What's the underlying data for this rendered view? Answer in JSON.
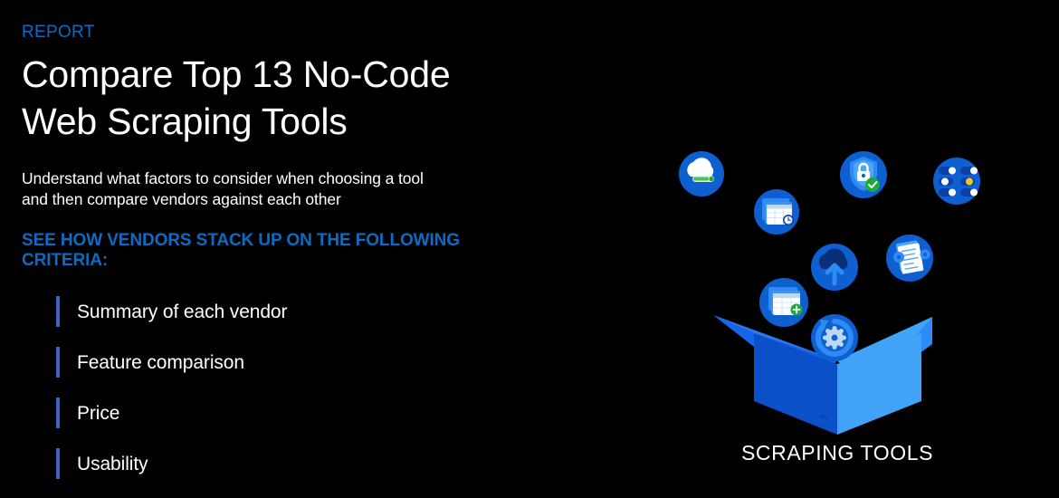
{
  "theme": {
    "background": "#000000",
    "accent_blue": "#0C6BC4",
    "bullet_bar": "#3F63C8",
    "text_white": "#FFFFFF",
    "box_left_face": "#0B50C8",
    "box_right_face": "#41A3F5",
    "box_left_flap": "#1565E8",
    "box_right_flap": "#2E8BF5",
    "icon_circle": "#0E5FD0",
    "icon_circle_dark": "#0B3FA8",
    "icon_light_blue": "#3A95F0",
    "badge_green": "#1FA938",
    "accent_yellow": "#F5C518"
  },
  "eyebrow": "REPORT",
  "headline": {
    "line1": "Compare Top 13 No-Code",
    "line2": "Web Scraping Tools"
  },
  "subcopy": {
    "line1": "Understand what factors to consider when choosing a tool",
    "line2": "and then compare vendors against each other"
  },
  "criteria_heading": {
    "line1": "SEE HOW VENDORS STACK UP ON THE FOLLOWING",
    "line2": "CRITERIA:"
  },
  "criteria": [
    {
      "label": "Summary of each vendor"
    },
    {
      "label": "Feature comparison"
    },
    {
      "label": "Price"
    },
    {
      "label": "Usability"
    }
  ],
  "illustration": {
    "box_label": "SCRAPING TOOLS",
    "icons": [
      {
        "name": "cloud-sync-icon",
        "alt": "cloud with green progress bar"
      },
      {
        "name": "spreadsheet-clock-icon",
        "alt": "spreadsheet window with clock badge"
      },
      {
        "name": "shield-lock-icon",
        "alt": "security shield with padlock and green check"
      },
      {
        "name": "data-grid-icon",
        "alt": "server data grid with status dots"
      },
      {
        "name": "cloud-upload-icon",
        "alt": "cloud with upload arrow"
      },
      {
        "name": "document-gears-icon",
        "alt": "document with gear settings"
      },
      {
        "name": "spreadsheet-add-icon",
        "alt": "spreadsheet window with green plus badge"
      },
      {
        "name": "sync-gear-icon",
        "alt": "refresh arrows around a gear"
      }
    ]
  }
}
